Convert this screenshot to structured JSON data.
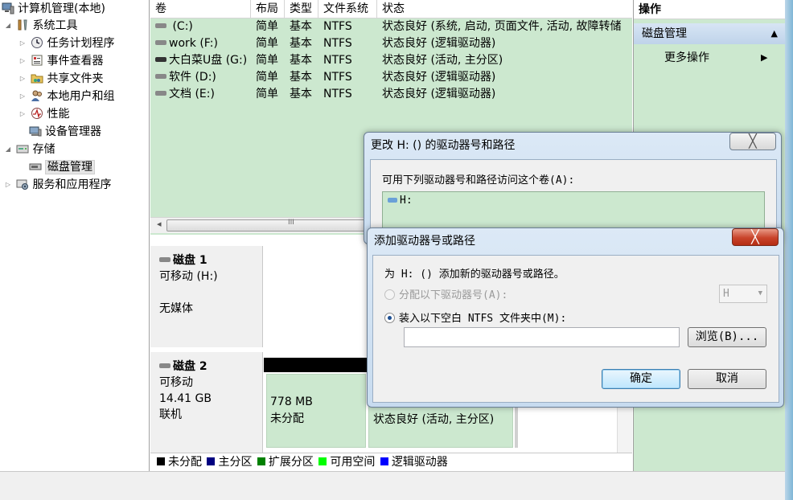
{
  "tree": {
    "root": "计算机管理(本地)",
    "system_tools": "系统工具",
    "task_scheduler": "任务计划程序",
    "event_viewer": "事件查看器",
    "shared_folders": "共享文件夹",
    "local_users": "本地用户和组",
    "performance": "性能",
    "device_manager": "设备管理器",
    "storage": "存储",
    "disk_management": "磁盘管理",
    "services_apps": "服务和应用程序"
  },
  "volume_list": {
    "columns": [
      "卷",
      "布局",
      "类型",
      "文件系统",
      "状态"
    ],
    "rows": [
      {
        "volume": " (C:)",
        "layout": "简单",
        "type": "基本",
        "fs": "NTFS",
        "status": "状态良好 (系统, 启动, 页面文件, 活动, 故障转储"
      },
      {
        "volume": "work (F:)",
        "layout": "简单",
        "type": "基本",
        "fs": "NTFS",
        "status": "状态良好 (逻辑驱动器)"
      },
      {
        "volume": "大白菜U盘 (G:)",
        "layout": "简单",
        "type": "基本",
        "fs": "NTFS",
        "status": "状态良好 (活动, 主分区)"
      },
      {
        "volume": "软件 (D:)",
        "layout": "简单",
        "type": "基本",
        "fs": "NTFS",
        "status": "状态良好 (逻辑驱动器)"
      },
      {
        "volume": "文档 (E:)",
        "layout": "简单",
        "type": "基本",
        "fs": "NTFS",
        "status": "状态良好 (逻辑驱动器)"
      }
    ],
    "scroll_left": "◂",
    "scroll_grip": "III"
  },
  "disks": {
    "disk1": {
      "name": "磁盘 1",
      "type": "可移动 (H:)",
      "media": "无媒体"
    },
    "disk2": {
      "name": "磁盘 2",
      "type": "可移动",
      "size": "14.41 GB",
      "state": "联机"
    },
    "part_unalloc_size": "778 MB",
    "part_unalloc_label": "未分配",
    "part_primary_status": "状态良好 (活动, 主分区)"
  },
  "legend": {
    "items": [
      {
        "label": "未分配",
        "color": "#000000"
      },
      {
        "label": "主分区",
        "color": "#000080"
      },
      {
        "label": "扩展分区",
        "color": "#008000"
      },
      {
        "label": "可用空间",
        "color": "#00ff00"
      },
      {
        "label": "逻辑驱动器",
        "color": "#0000ff"
      }
    ]
  },
  "actions": {
    "header": "操作",
    "section": "磁盘管理",
    "more": "更多操作",
    "section_arrow": "▲",
    "more_arrow": "▶"
  },
  "dialog_change": {
    "title": "更改 H: () 的驱动器号和路径",
    "desc": "可用下列驱动器号和路径访问这个卷(A):",
    "list_item": "H:",
    "close": "╳"
  },
  "dialog_add": {
    "title": "添加驱动器号或路径",
    "desc": "为 H: () 添加新的驱动器号或路径。",
    "opt_assign": "分配以下驱动器号(A):",
    "drive_letter": "H",
    "opt_mount": "装入以下空白 NTFS 文件夹中(M):",
    "path_value": "",
    "browse": "浏览(B)...",
    "ok": "确定",
    "cancel": "取消",
    "close": "╳"
  }
}
